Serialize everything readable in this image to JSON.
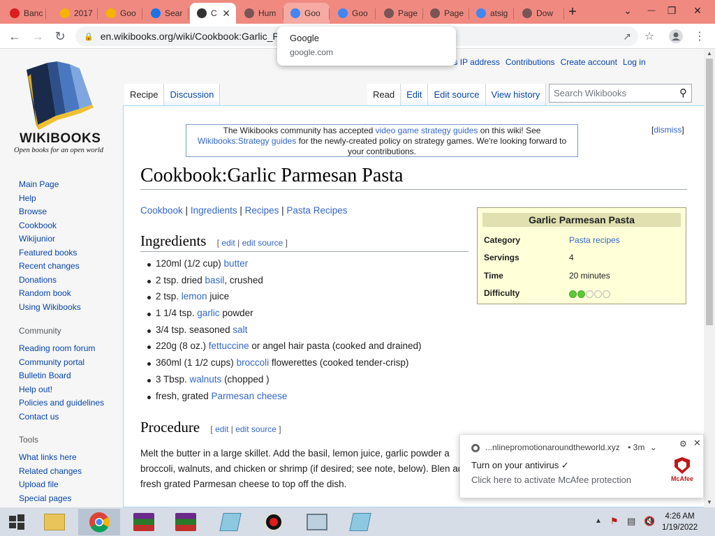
{
  "browser": {
    "tabs": [
      {
        "label": "Banc",
        "icon": "red-record-icon",
        "color": "#d81e1e"
      },
      {
        "label": "2017",
        "icon": "google-drive-icon",
        "color": "#f4b400"
      },
      {
        "label": "Goo",
        "icon": "google-drive-icon",
        "color": "#f4b400"
      },
      {
        "label": "Sear",
        "icon": "search-app-icon",
        "color": "#1a73e8"
      },
      {
        "label": "C",
        "icon": "wikibooks-icon",
        "color": "#333333"
      },
      {
        "label": "Hum",
        "icon": "globe-icon",
        "color": "#7a5555"
      },
      {
        "label": "Goo",
        "icon": "google-icon",
        "color": "#4285f4"
      },
      {
        "label": "Goo",
        "icon": "google-icon",
        "color": "#4285f4"
      },
      {
        "label": "Page",
        "icon": "globe-icon",
        "color": "#7a5555"
      },
      {
        "label": "Page",
        "icon": "globe-icon",
        "color": "#7a5555"
      },
      {
        "label": "atsig",
        "icon": "google-icon",
        "color": "#4285f4"
      },
      {
        "label": "Dow",
        "icon": "download-icon",
        "color": "#7a5555"
      }
    ],
    "url": "en.wikibooks.org/wiki/Cookbook:Garlic_P",
    "tooltip": {
      "title": "Google",
      "domain": "google.com"
    }
  },
  "personal": [
    "ssion for this IP address",
    "Contributions",
    "Create account",
    "Log in"
  ],
  "sidebar": {
    "logo_word": "WIKIBOOKS",
    "logo_tagline": "Open books for an open world",
    "main": [
      "Main Page",
      "Help",
      "Browse",
      "Cookbook",
      "Wikijunior",
      "Featured books",
      "Recent changes",
      "Donations",
      "Random book",
      "Using Wikibooks"
    ],
    "community_head": "Community",
    "community": [
      "Reading room forum",
      "Community portal",
      "Bulletin Board",
      "Help out!",
      "Policies and guidelines",
      "Contact us"
    ],
    "tools_head": "Tools",
    "tools": [
      "What links here",
      "Related changes",
      "Upload file",
      "Special pages"
    ]
  },
  "page_tabs": {
    "left": [
      "Recipe",
      "Discussion"
    ],
    "right": [
      "Read",
      "Edit",
      "Edit source",
      "View history"
    ],
    "search_placeholder": "Search Wikibooks"
  },
  "notice": {
    "t1": "The Wikibooks community has accepted ",
    "link1": "video game strategy guides",
    "t2": " on this wiki! See ",
    "link2": "Wikibooks:Strategy guides",
    "t3": " for the newly-created policy on strategy games. We're looking forward to your contributions.",
    "dismiss": "dismiss"
  },
  "article": {
    "title": "Cookbook:Garlic Parmesan Pasta",
    "categories": [
      "Cookbook",
      "Ingredients",
      "Recipes",
      "Pasta Recipes"
    ],
    "ingredients_heading": "Ingredients",
    "edit": "edit",
    "edit_source": "edit source",
    "ingredients": [
      {
        "pre": "120ml (1/2 cup) ",
        "link": "butter",
        "post": ""
      },
      {
        "pre": "2 tsp. dried ",
        "link": "basil",
        "post": ", crushed"
      },
      {
        "pre": "2 tsp. ",
        "link": "lemon",
        "post": " juice"
      },
      {
        "pre": "1 1/4 tsp. ",
        "link": "garlic",
        "post": " powder"
      },
      {
        "pre": "3/4 tsp. seasoned ",
        "link": "salt",
        "post": ""
      },
      {
        "pre": "220g (8 oz.) ",
        "link": "fettuccine",
        "post": " or angel hair pasta (cooked and drained)"
      },
      {
        "pre": "360ml (1 1/2 cups) ",
        "link": "broccoli",
        "post": " flowerettes (cooked tender-crisp)"
      },
      {
        "pre": "3 Tbsp. ",
        "link": "walnuts",
        "post": " (chopped )"
      },
      {
        "pre": "fresh, grated ",
        "link": "Parmesan cheese",
        "post": ""
      }
    ],
    "procedure_heading": "Procedure",
    "procedure_text": "Melt the butter in a large skillet. Add the basil, lemon juice, garlic powder a broccoli, walnuts, and chicken or shrimp (if desired; see note, below). Blen add fresh grated Parmesan cheese to top off the dish."
  },
  "infobox": {
    "title": "Garlic Parmesan Pasta",
    "rows": [
      {
        "key": "Category",
        "value": "Pasta recipes",
        "link": true
      },
      {
        "key": "Servings",
        "value": "4",
        "link": false
      },
      {
        "key": "Time",
        "value": "20 minutes",
        "link": false
      },
      {
        "key": "Difficulty",
        "value": "",
        "link": false
      }
    ],
    "difficulty_level": 2,
    "difficulty_max": 5
  },
  "toast": {
    "source": "...nlinepromotionaroundtheworld.xyz",
    "age": "• 3m",
    "line1": "Turn on your antivirus ✓",
    "line2": "Click here to activate McAfee protection",
    "brand": "McAfee"
  },
  "taskbar": {
    "time": "4:26 AM",
    "date": "1/19/2022"
  }
}
